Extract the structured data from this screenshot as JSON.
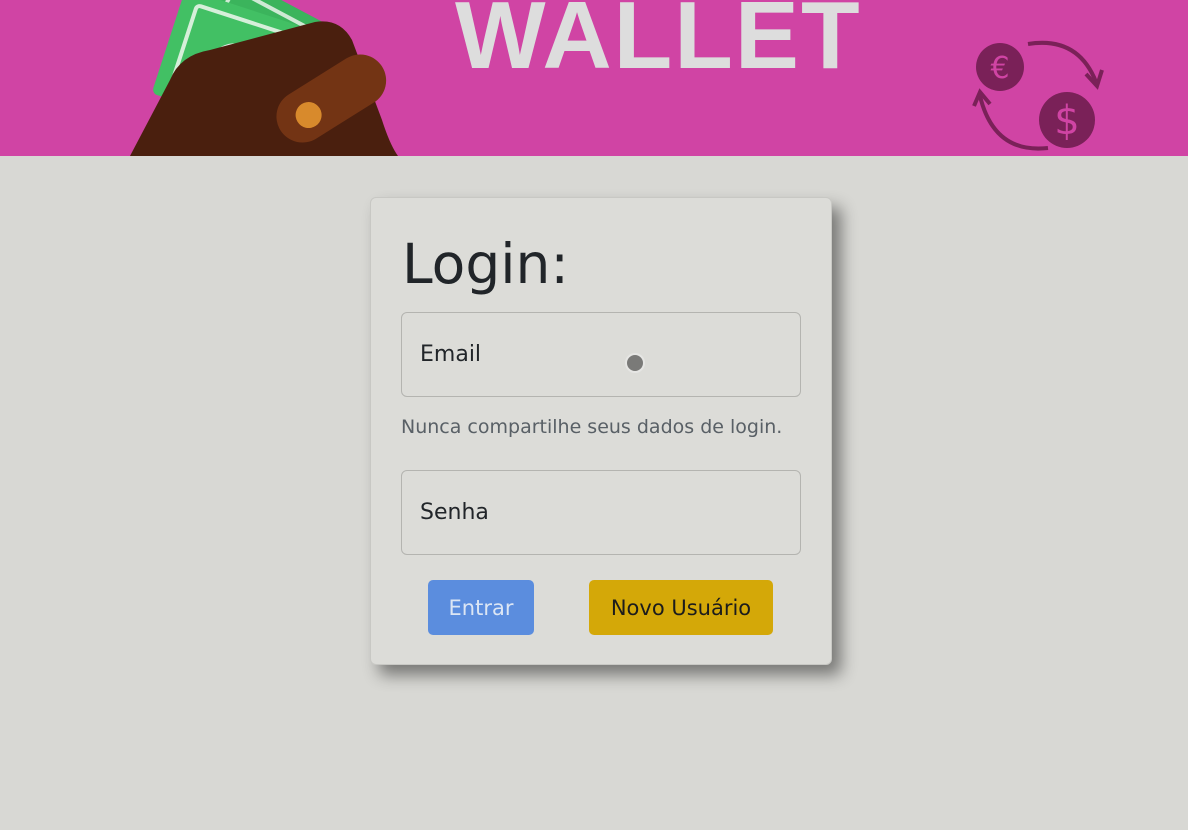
{
  "banner": {
    "title": "WALLET",
    "wallet_icon": "wallet-with-cash-icon",
    "exchange_icon": "currency-exchange-icon",
    "exchange_symbols": {
      "euro": "€",
      "dollar": "$"
    }
  },
  "login": {
    "title": "Login:",
    "email_placeholder": "Email",
    "email_help": "Nunca compartilhe seus dados de login.",
    "password_placeholder": "Senha",
    "submit_label": "Entrar",
    "register_label": "Novo Usuário"
  },
  "colors": {
    "banner": "#d044a4",
    "background": "#d8d8d4",
    "primary_button": "#5b8dde",
    "warning_button": "#d4a808"
  }
}
